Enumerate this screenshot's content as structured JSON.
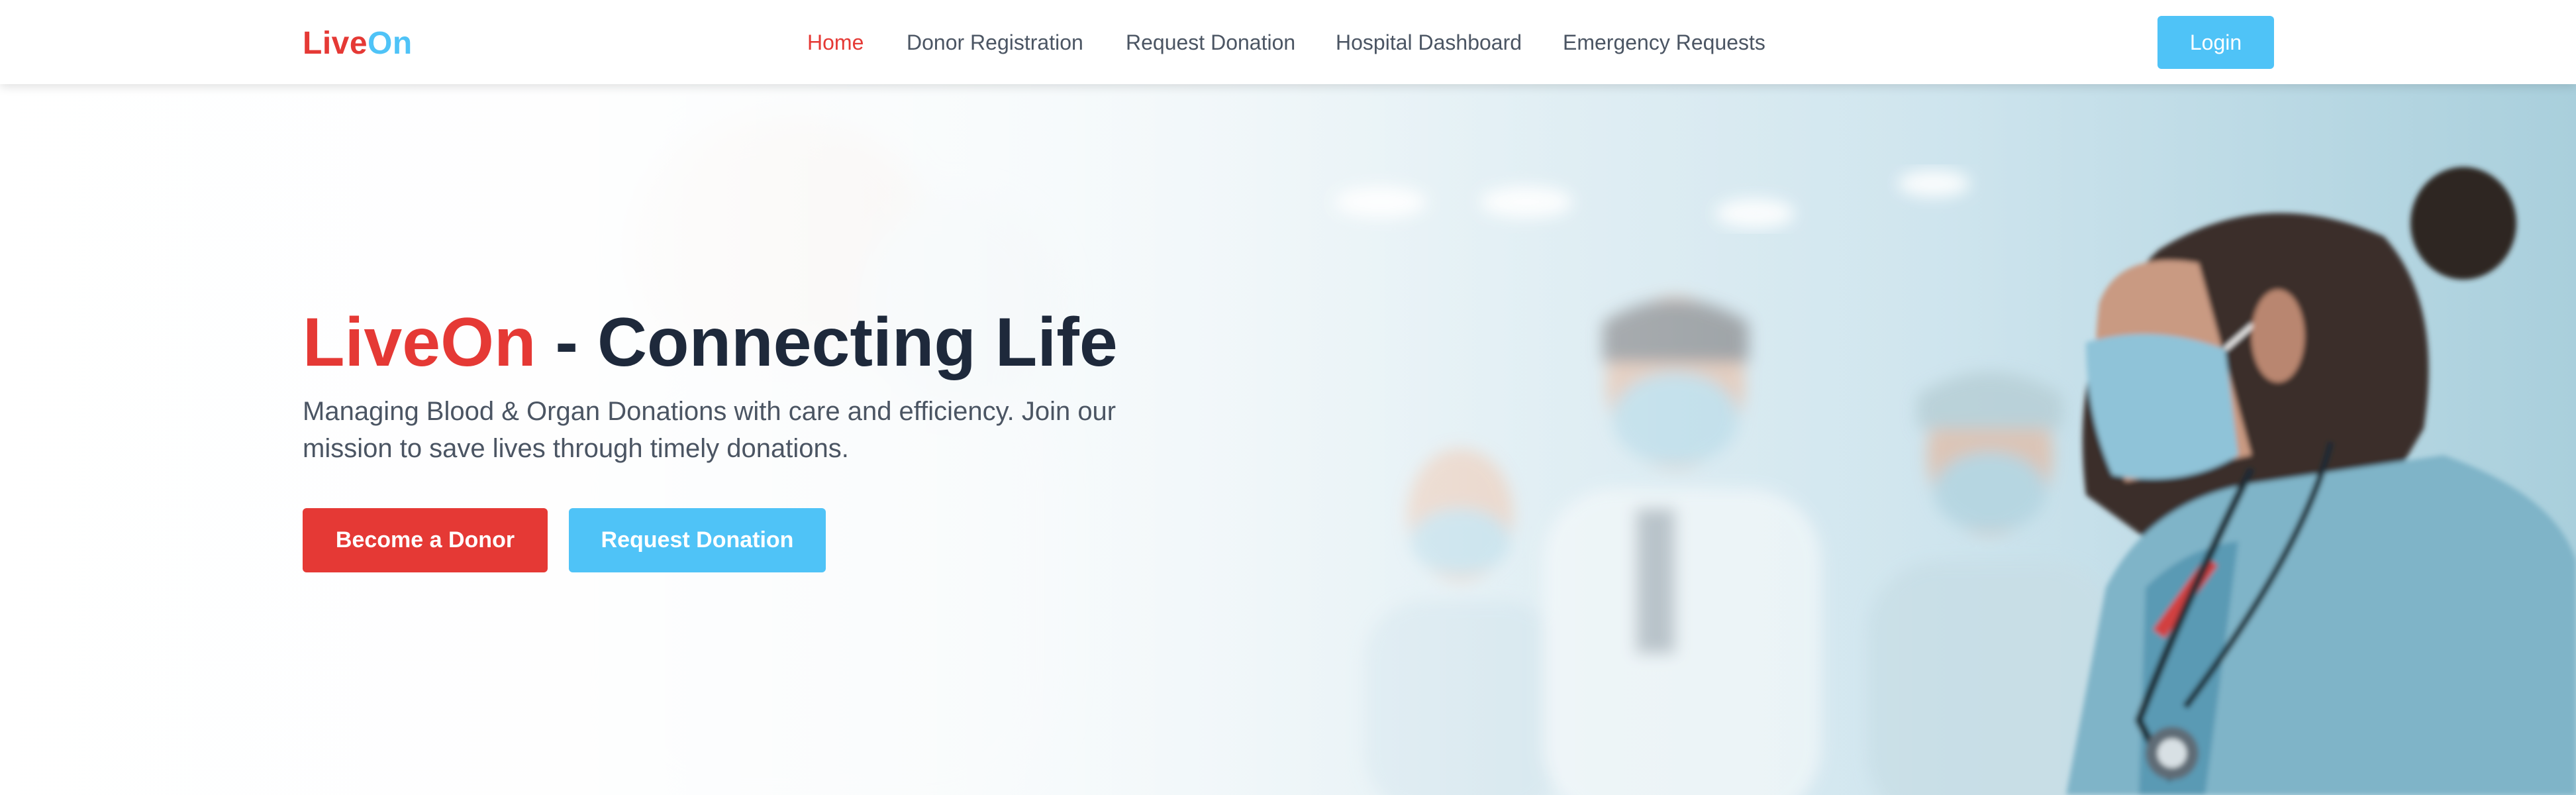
{
  "brand": {
    "part1": "Live",
    "part2": "On",
    "red": "#e53935",
    "blue": "#4fc3f7"
  },
  "nav": {
    "items": [
      {
        "label": "Home",
        "active": true
      },
      {
        "label": "Donor Registration",
        "active": false
      },
      {
        "label": "Request Donation",
        "active": false
      },
      {
        "label": "Hospital Dashboard",
        "active": false
      },
      {
        "label": "Emergency Requests",
        "active": false
      }
    ],
    "login_label": "Login"
  },
  "hero": {
    "title_brand": "LiveOn",
    "title_rest": " - Connecting Life",
    "subtitle": "Managing Blood & Organ Donations with care and efficiency. Join our mission to save lives through timely donations.",
    "primary_button": "Become a Donor",
    "secondary_button": "Request Donation",
    "background_image": "blurred-hospital-staff-with-face-masks"
  }
}
